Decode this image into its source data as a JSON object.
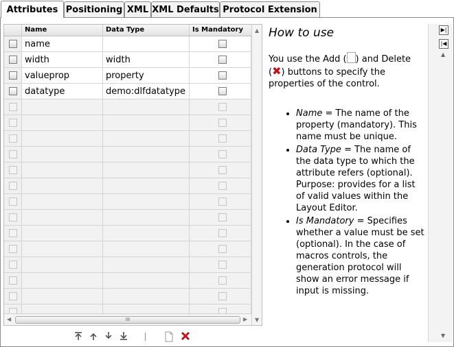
{
  "tabs": [
    {
      "label": "Attributes",
      "active": true
    },
    {
      "label": "Positioning",
      "active": false
    },
    {
      "label": "XML",
      "active": false
    },
    {
      "label": "XML Defaults",
      "active": false
    },
    {
      "label": "Protocol Extension",
      "active": false
    }
  ],
  "grid": {
    "columns": [
      "Name",
      "Data Type",
      "Is Mandatory"
    ],
    "rows": [
      {
        "name": "name",
        "data_type": "",
        "mandatory": false
      },
      {
        "name": "width",
        "data_type": "width",
        "mandatory": false
      },
      {
        "name": "valueprop",
        "data_type": "property",
        "mandatory": false
      },
      {
        "name": "datatype",
        "data_type": "demo:dlfdatatype",
        "mandatory": false
      }
    ],
    "empty_rows": 14,
    "hscroll_grip": "III"
  },
  "toolbar": {
    "move_top_icon": "move-top-icon",
    "move_up_icon": "move-up-icon",
    "move_down_icon": "move-down-icon",
    "move_bottom_icon": "move-bottom-icon",
    "add_icon": "new-document-icon",
    "delete_icon": "delete-x-icon"
  },
  "help": {
    "title": "How to use",
    "intro_1": "You use the Add (",
    "intro_2": ") and Delete",
    "intro_3": "(",
    "intro_4": ") buttons to specify the properties of the control.",
    "items": [
      {
        "term": "Name",
        "text": " = The name of the property (mandatory). This name must be unique."
      },
      {
        "term": "Data Type",
        "text": " = The name of the data type to which the attribute refers (optional). Purpose: provides for a list of valid values within the Layout Editor."
      },
      {
        "term": "Is Mandatory",
        "text": " = Specifies whether a value must be set (optional). In the case of macros controls, the generation protocol will show an error message if input is missing."
      }
    ]
  },
  "colors": {
    "delete_red": "#c0121b",
    "border": "#8a8a8a"
  }
}
